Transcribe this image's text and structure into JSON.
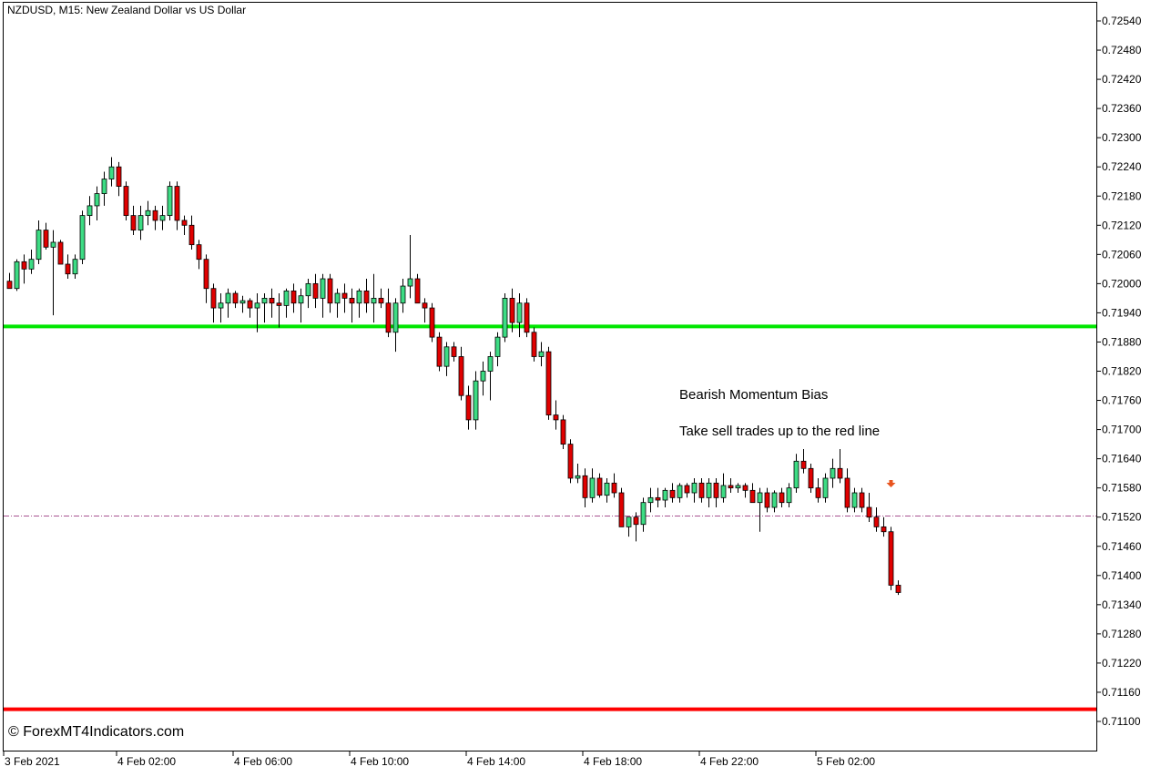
{
  "chart_data": {
    "type": "candlestick",
    "title": "NZDUSD, M15:  New Zealand Dollar vs US Dollar",
    "symbol": "NZDUSD",
    "timeframe": "M15",
    "description": "New Zealand Dollar vs US Dollar",
    "ylim": [
      0.7107,
      0.7257
    ],
    "y_ticks": [
      "0.72540",
      "0.72480",
      "0.72420",
      "0.72360",
      "0.72300",
      "0.72240",
      "0.72180",
      "0.72120",
      "0.72060",
      "0.72000",
      "0.71940",
      "0.71880",
      "0.71820",
      "0.71760",
      "0.71700",
      "0.71640",
      "0.71580",
      "0.71520",
      "0.71460",
      "0.71400",
      "0.71340",
      "0.71280",
      "0.71220",
      "0.71160",
      "0.71100"
    ],
    "x_ticks": [
      "3 Feb 2021",
      "4 Feb 02:00",
      "4 Feb 06:00",
      "4 Feb 10:00",
      "4 Feb 14:00",
      "4 Feb 18:00",
      "4 Feb 22:00",
      "5 Feb 02:00"
    ],
    "grid": false,
    "colors": {
      "bull": "#3ddc84",
      "bear": "#e00000",
      "support": "#00e600",
      "resistance": "#ff0000",
      "current": "#8b1a6b",
      "arrow": "#e8541e"
    },
    "levels": {
      "green_line": 0.71912,
      "red_line": 0.71125,
      "current_price": 0.71522
    },
    "annotations": [
      "Bearish Momentum Bias",
      "Take sell trades up to the red line"
    ],
    "sell_arrow_index": 121,
    "candles": [
      [
        0.72005,
        0.72022,
        0.7199,
        0.7199
      ],
      [
        0.7199,
        0.7205,
        0.71985,
        0.72045
      ],
      [
        0.72045,
        0.7206,
        0.72,
        0.7203
      ],
      [
        0.7203,
        0.7207,
        0.7202,
        0.7205
      ],
      [
        0.7205,
        0.7213,
        0.7204,
        0.7211
      ],
      [
        0.7211,
        0.72125,
        0.7207,
        0.72075
      ],
      [
        0.72075,
        0.7211,
        0.71935,
        0.72085
      ],
      [
        0.72085,
        0.7209,
        0.7205,
        0.7204
      ],
      [
        0.7204,
        0.7206,
        0.7201,
        0.7202
      ],
      [
        0.7202,
        0.7206,
        0.7201,
        0.7205
      ],
      [
        0.7205,
        0.7215,
        0.7204,
        0.7214
      ],
      [
        0.7214,
        0.7218,
        0.7212,
        0.7216
      ],
      [
        0.7216,
        0.722,
        0.7213,
        0.72185
      ],
      [
        0.72185,
        0.7223,
        0.7216,
        0.72215
      ],
      [
        0.72215,
        0.7226,
        0.722,
        0.7224
      ],
      [
        0.7224,
        0.7225,
        0.7218,
        0.722
      ],
      [
        0.722,
        0.7221,
        0.7213,
        0.7214
      ],
      [
        0.7214,
        0.7216,
        0.721,
        0.7211
      ],
      [
        0.7211,
        0.7216,
        0.7209,
        0.7214
      ],
      [
        0.7214,
        0.7217,
        0.7212,
        0.7215
      ],
      [
        0.7215,
        0.7216,
        0.7211,
        0.7213
      ],
      [
        0.7213,
        0.7216,
        0.7211,
        0.7214
      ],
      [
        0.7214,
        0.7221,
        0.7213,
        0.722
      ],
      [
        0.722,
        0.7221,
        0.7211,
        0.7213
      ],
      [
        0.7213,
        0.7214,
        0.721,
        0.7212
      ],
      [
        0.7212,
        0.7214,
        0.7207,
        0.7208
      ],
      [
        0.7208,
        0.7209,
        0.7203,
        0.7205
      ],
      [
        0.7205,
        0.7206,
        0.7196,
        0.7199
      ],
      [
        0.7199,
        0.72,
        0.7192,
        0.7195
      ],
      [
        0.7195,
        0.7198,
        0.7192,
        0.7196
      ],
      [
        0.7196,
        0.7199,
        0.7193,
        0.7198
      ],
      [
        0.7198,
        0.71985,
        0.7195,
        0.7196
      ],
      [
        0.7196,
        0.71975,
        0.7194,
        0.71965
      ],
      [
        0.71965,
        0.7197,
        0.7193,
        0.7195
      ],
      [
        0.7195,
        0.7198,
        0.719,
        0.7196
      ],
      [
        0.7196,
        0.7198,
        0.7192,
        0.7197
      ],
      [
        0.7197,
        0.7199,
        0.7193,
        0.7196
      ],
      [
        0.7196,
        0.7198,
        0.7191,
        0.71955
      ],
      [
        0.71955,
        0.7199,
        0.7193,
        0.71985
      ],
      [
        0.71985,
        0.72,
        0.7194,
        0.7196
      ],
      [
        0.7196,
        0.7199,
        0.7192,
        0.71975
      ],
      [
        0.71975,
        0.7201,
        0.7195,
        0.72
      ],
      [
        0.72,
        0.7202,
        0.7195,
        0.7197
      ],
      [
        0.7197,
        0.7202,
        0.7193,
        0.7201
      ],
      [
        0.7201,
        0.7202,
        0.7194,
        0.7196
      ],
      [
        0.7196,
        0.7199,
        0.7193,
        0.7198
      ],
      [
        0.7198,
        0.72,
        0.7194,
        0.7197
      ],
      [
        0.7197,
        0.7199,
        0.7192,
        0.7196
      ],
      [
        0.7196,
        0.7199,
        0.7193,
        0.71985
      ],
      [
        0.71985,
        0.7201,
        0.7194,
        0.7196
      ],
      [
        0.7196,
        0.7202,
        0.7192,
        0.7197
      ],
      [
        0.7197,
        0.7199,
        0.7195,
        0.7196
      ],
      [
        0.7196,
        0.7199,
        0.7189,
        0.719
      ],
      [
        0.719,
        0.7197,
        0.7186,
        0.7196
      ],
      [
        0.7196,
        0.7201,
        0.7194,
        0.71995
      ],
      [
        0.71995,
        0.721,
        0.7197,
        0.7201
      ],
      [
        0.7201,
        0.7202,
        0.7197,
        0.7196
      ],
      [
        0.7196,
        0.7197,
        0.7192,
        0.7195
      ],
      [
        0.7195,
        0.7196,
        0.7188,
        0.7189
      ],
      [
        0.7189,
        0.719,
        0.7182,
        0.7183
      ],
      [
        0.7183,
        0.7188,
        0.7181,
        0.7187
      ],
      [
        0.7187,
        0.7188,
        0.7184,
        0.7185
      ],
      [
        0.7185,
        0.7187,
        0.7176,
        0.7177
      ],
      [
        0.7177,
        0.7179,
        0.717,
        0.7172
      ],
      [
        0.7172,
        0.7182,
        0.717,
        0.718
      ],
      [
        0.718,
        0.7184,
        0.7177,
        0.7182
      ],
      [
        0.7182,
        0.7186,
        0.7176,
        0.7185
      ],
      [
        0.7185,
        0.719,
        0.7183,
        0.7189
      ],
      [
        0.7189,
        0.7198,
        0.7188,
        0.7197
      ],
      [
        0.7197,
        0.7199,
        0.719,
        0.7192
      ],
      [
        0.7192,
        0.7198,
        0.7189,
        0.7196
      ],
      [
        0.7196,
        0.7197,
        0.7189,
        0.719
      ],
      [
        0.719,
        0.7191,
        0.7184,
        0.7185
      ],
      [
        0.7185,
        0.7188,
        0.7183,
        0.7186
      ],
      [
        0.7186,
        0.7187,
        0.7172,
        0.7173
      ],
      [
        0.7173,
        0.7176,
        0.717,
        0.7172
      ],
      [
        0.7172,
        0.7173,
        0.7166,
        0.7167
      ],
      [
        0.7167,
        0.7168,
        0.7159,
        0.716
      ],
      [
        0.716,
        0.7163,
        0.7159,
        0.71605
      ],
      [
        0.71605,
        0.7162,
        0.7154,
        0.7156
      ],
      [
        0.7156,
        0.7162,
        0.7155,
        0.716
      ],
      [
        0.716,
        0.7161,
        0.7156,
        0.71565
      ],
      [
        0.71565,
        0.716,
        0.7155,
        0.7159
      ],
      [
        0.7159,
        0.7161,
        0.7156,
        0.7157
      ],
      [
        0.7157,
        0.7158,
        0.715,
        0.715
      ],
      [
        0.715,
        0.7152,
        0.7148,
        0.7152
      ],
      [
        0.7152,
        0.7153,
        0.7147,
        0.71505
      ],
      [
        0.71505,
        0.7156,
        0.7149,
        0.7155
      ],
      [
        0.7155,
        0.7158,
        0.7153,
        0.7156
      ],
      [
        0.7156,
        0.7158,
        0.7154,
        0.71555
      ],
      [
        0.71555,
        0.7158,
        0.7154,
        0.71575
      ],
      [
        0.71575,
        0.7159,
        0.7155,
        0.7156
      ],
      [
        0.7156,
        0.7159,
        0.7155,
        0.71585
      ],
      [
        0.71585,
        0.7159,
        0.7156,
        0.7157
      ],
      [
        0.7157,
        0.716,
        0.7155,
        0.7159
      ],
      [
        0.7159,
        0.716,
        0.7155,
        0.7156
      ],
      [
        0.7156,
        0.716,
        0.7154,
        0.7159
      ],
      [
        0.7159,
        0.716,
        0.7154,
        0.7156
      ],
      [
        0.7156,
        0.7161,
        0.7155,
        0.71585
      ],
      [
        0.71585,
        0.716,
        0.7157,
        0.7158
      ],
      [
        0.7158,
        0.7159,
        0.7157,
        0.71585
      ],
      [
        0.71585,
        0.7159,
        0.7156,
        0.71575
      ],
      [
        0.71575,
        0.7159,
        0.7155,
        0.7155
      ],
      [
        0.7155,
        0.7158,
        0.7149,
        0.7157
      ],
      [
        0.7157,
        0.7158,
        0.7153,
        0.7154
      ],
      [
        0.7154,
        0.71575,
        0.7153,
        0.7157
      ],
      [
        0.7157,
        0.7158,
        0.7154,
        0.7155
      ],
      [
        0.7155,
        0.7159,
        0.7154,
        0.7158
      ],
      [
        0.7158,
        0.7165,
        0.7157,
        0.71635
      ],
      [
        0.71635,
        0.7166,
        0.7161,
        0.7162
      ],
      [
        0.7162,
        0.7163,
        0.7157,
        0.7158
      ],
      [
        0.7158,
        0.716,
        0.7155,
        0.7156
      ],
      [
        0.7156,
        0.7161,
        0.7155,
        0.716
      ],
      [
        0.716,
        0.7164,
        0.7158,
        0.7162
      ],
      [
        0.7162,
        0.7166,
        0.7159,
        0.716
      ],
      [
        0.716,
        0.7162,
        0.7153,
        0.7154
      ],
      [
        0.7154,
        0.7158,
        0.7153,
        0.7157
      ],
      [
        0.7157,
        0.7158,
        0.7153,
        0.7154
      ],
      [
        0.7154,
        0.7157,
        0.7151,
        0.7152
      ],
      [
        0.7152,
        0.7154,
        0.7149,
        0.715
      ],
      [
        0.715,
        0.7152,
        0.7148,
        0.7149
      ],
      [
        0.7149,
        0.715,
        0.7137,
        0.7138
      ],
      [
        0.7138,
        0.7139,
        0.7136,
        0.71365
      ]
    ]
  },
  "watermark": "© ForexMT4Indicators.com"
}
